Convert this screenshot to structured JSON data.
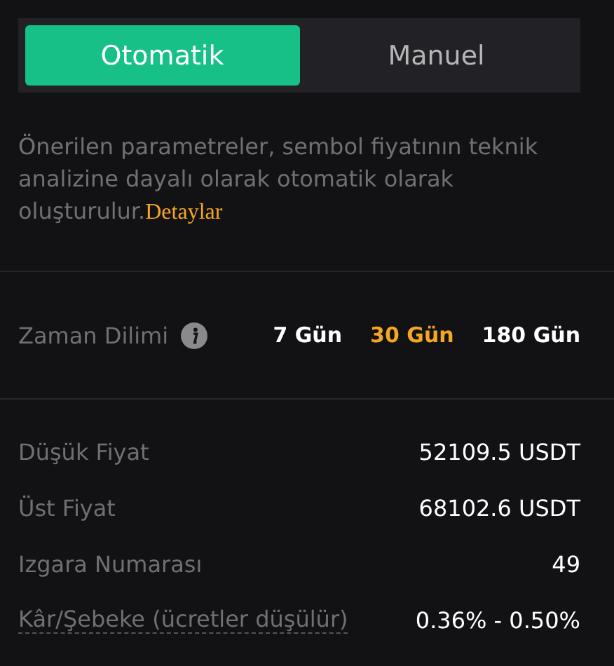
{
  "tabs": [
    {
      "label": "Otomatik",
      "selected": true
    },
    {
      "label": "Manuel",
      "selected": false
    }
  ],
  "description": {
    "text": "Önerilen parametreler, sembol fiyatının teknik analizine dayalı olarak otomatik olarak oluşturulur.",
    "link": "Detaylar"
  },
  "time_frame": {
    "label": "Zaman Dilimi",
    "options": [
      {
        "label": "7 Gün",
        "selected": false
      },
      {
        "label": "30 Gün",
        "selected": true
      },
      {
        "label": "180 Gün",
        "selected": false
      }
    ]
  },
  "params": [
    {
      "label": "Düşük Fiyat",
      "value": "52109.5 USDT",
      "underlined": false
    },
    {
      "label": "Üst Fiyat",
      "value": "68102.6 USDT",
      "underlined": false
    },
    {
      "label": "Izgara Numarası",
      "value": "49",
      "underlined": false
    },
    {
      "label": "Kâr/Şebeke (ücretler düşülür)",
      "value": "0.36% - 0.50%",
      "underlined": true
    }
  ]
}
